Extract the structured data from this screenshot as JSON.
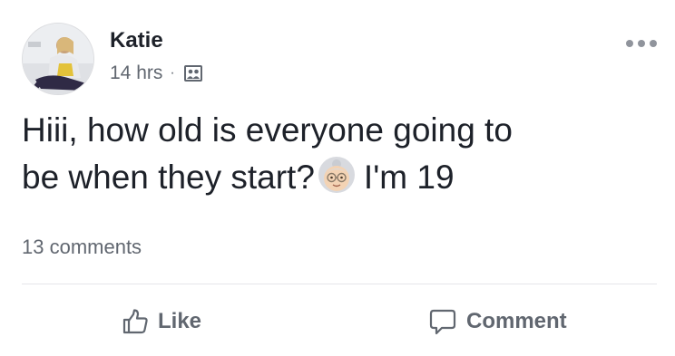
{
  "post": {
    "author": "Katie",
    "timestamp": "14 hrs",
    "separator": "·",
    "audience_icon": "group-icon",
    "more_icon": "more-options-icon",
    "text_line1": "Hiii, how old is everyone going to",
    "text_line2_before": "be when they start?",
    "emoji": "older-woman-emoji",
    "text_line2_after": "I'm 19",
    "comment_count": "13 comments"
  },
  "actions": {
    "like_label": "Like",
    "like_icon": "thumbs-up-icon",
    "comment_label": "Comment",
    "comment_icon": "speech-bubble-icon"
  },
  "colors": {
    "text_primary": "#1d2129",
    "text_secondary": "#616770",
    "divider": "#e5e6e9"
  }
}
